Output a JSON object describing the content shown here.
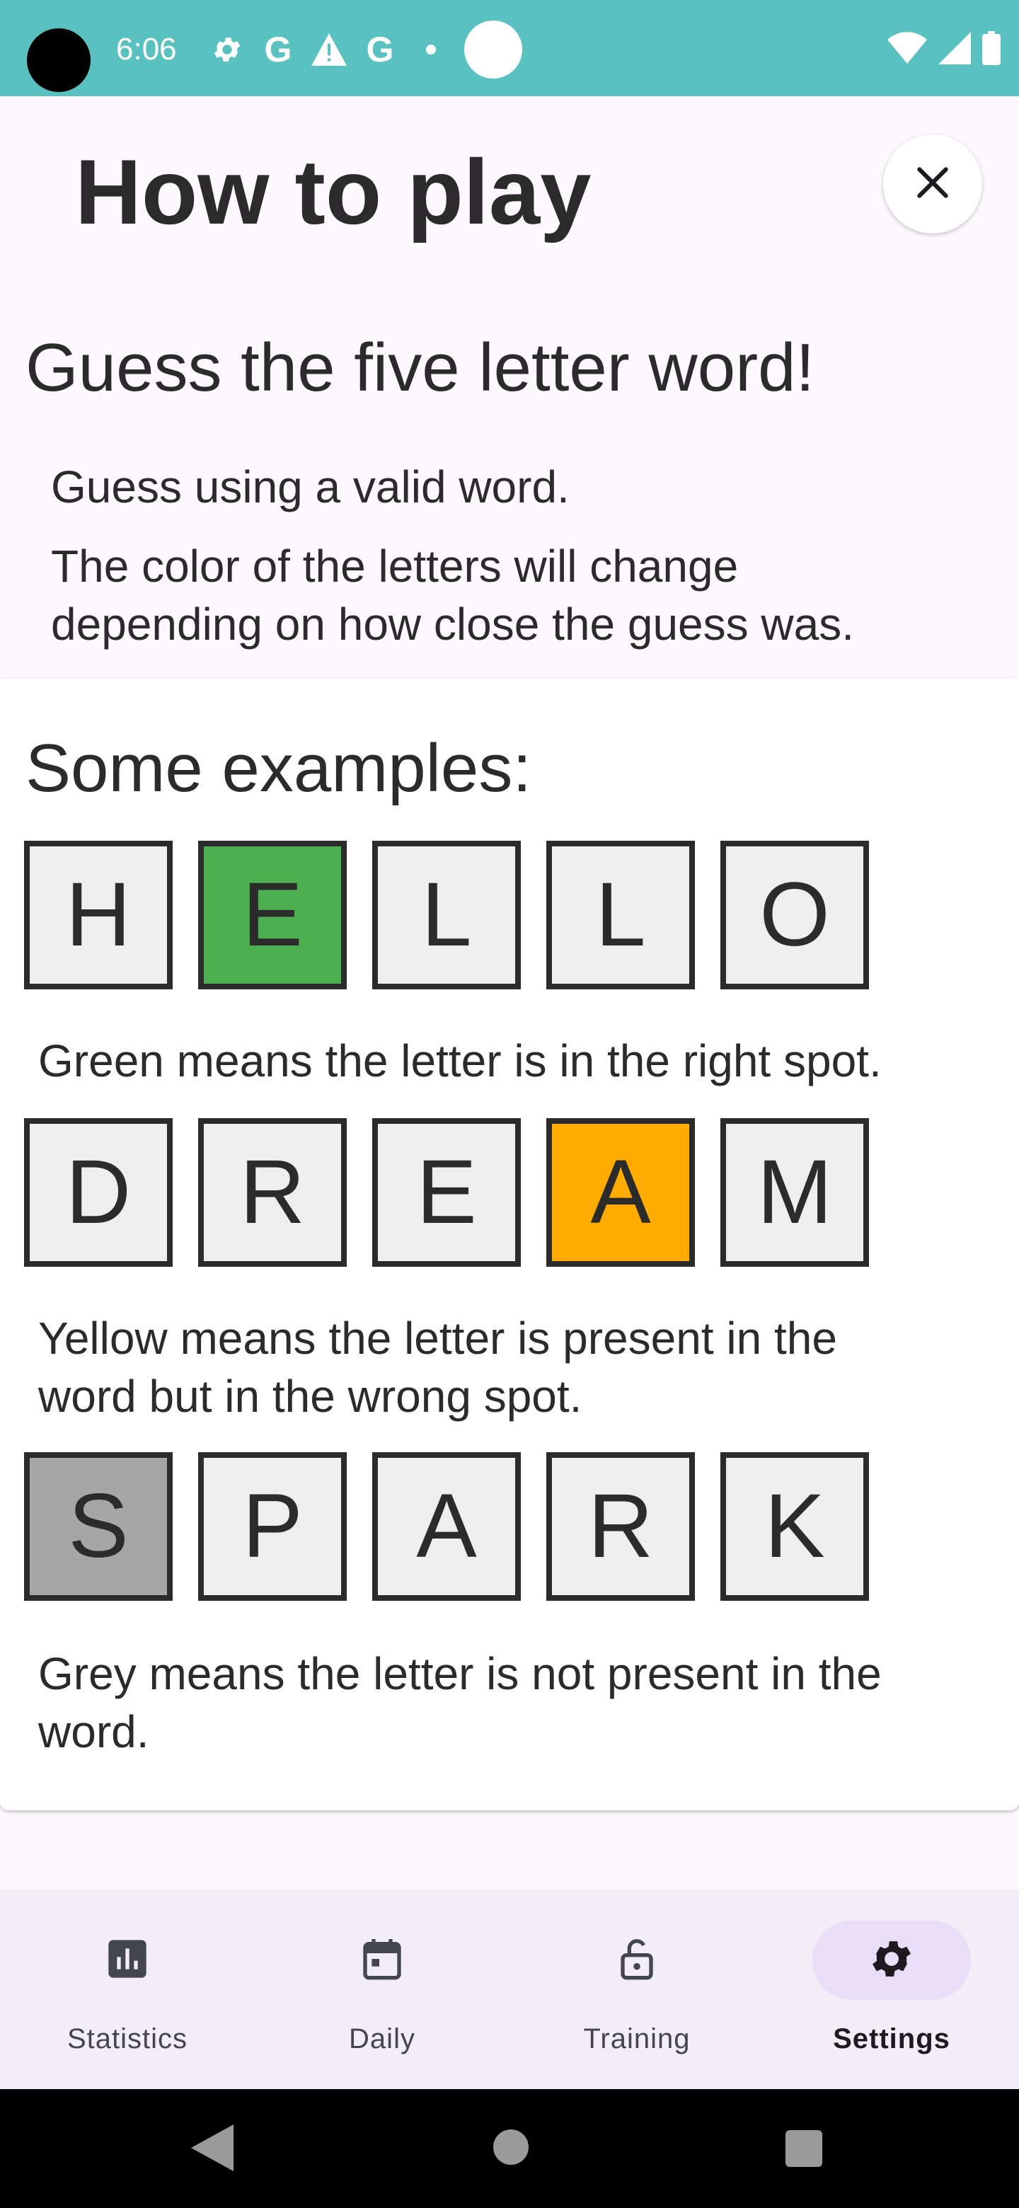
{
  "status_bar": {
    "time": "6:06",
    "left_icons": [
      "settings-icon",
      "google-icon",
      "warning-icon",
      "google-icon",
      "dot-icon",
      "circle-icon"
    ],
    "right_icons": [
      "wifi-icon",
      "signal-icon",
      "battery-icon"
    ],
    "background": "#59c1c0"
  },
  "header": {
    "title": "How to play",
    "close_icon": "close-icon"
  },
  "intro": {
    "heading": "Guess the five letter word!",
    "line1": "Guess using a valid word.",
    "line2a": "The color of the letters will change",
    "line2b": "depending on how close the guess was."
  },
  "examples": {
    "heading": "Some examples:",
    "rows": [
      {
        "tiles": [
          {
            "letter": "H",
            "state": "none"
          },
          {
            "letter": "E",
            "state": "correct"
          },
          {
            "letter": "L",
            "state": "none"
          },
          {
            "letter": "L",
            "state": "none"
          },
          {
            "letter": "O",
            "state": "none"
          }
        ],
        "caption_lines": [
          "Green means the letter is in the right spot."
        ]
      },
      {
        "tiles": [
          {
            "letter": "D",
            "state": "none"
          },
          {
            "letter": "R",
            "state": "none"
          },
          {
            "letter": "E",
            "state": "none"
          },
          {
            "letter": "A",
            "state": "present"
          },
          {
            "letter": "M",
            "state": "none"
          }
        ],
        "caption_lines": [
          "Yellow means the letter is present in the",
          "word but in the wrong spot."
        ]
      },
      {
        "tiles": [
          {
            "letter": "S",
            "state": "absent"
          },
          {
            "letter": "P",
            "state": "none"
          },
          {
            "letter": "A",
            "state": "none"
          },
          {
            "letter": "R",
            "state": "none"
          },
          {
            "letter": "K",
            "state": "none"
          }
        ],
        "caption_lines": [
          "Grey means the letter is not present in the",
          "word."
        ]
      }
    ],
    "colors": {
      "correct": "#4caf50",
      "present": "#ffab00",
      "absent": "#a6a6a6",
      "empty": "#eeeeee"
    }
  },
  "bottom_nav": {
    "items": [
      {
        "label": "Statistics",
        "icon": "bar-chart-icon",
        "active": false
      },
      {
        "label": "Daily",
        "icon": "calendar-icon",
        "active": false
      },
      {
        "label": "Training",
        "icon": "lock-open-icon",
        "active": false
      },
      {
        "label": "Settings",
        "icon": "gear-icon",
        "active": true
      }
    ]
  },
  "system_nav": {
    "icons": [
      "back-icon",
      "home-icon",
      "recents-icon"
    ]
  }
}
